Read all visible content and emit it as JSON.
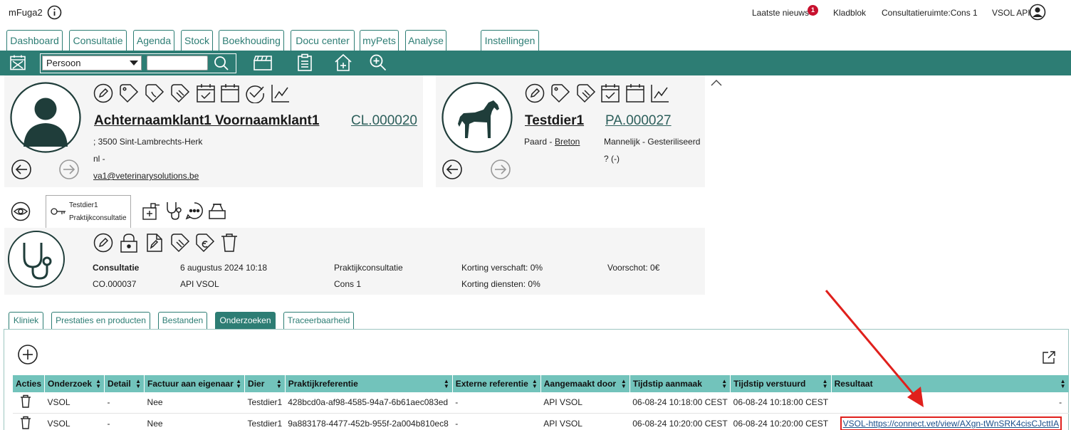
{
  "app": {
    "title": "mFuga2"
  },
  "topnav": {
    "news_label": "Laatste nieuws",
    "news_badge": "1",
    "notepad_label": "Kladblok",
    "room_label": "Consultatieruimte:Cons 1",
    "user_label": "VSOL API"
  },
  "main_tabs": [
    "Dashboard",
    "Consultatie",
    "Agenda",
    "Stock",
    "Boekhouding",
    "Docu center",
    "myPets",
    "Analyse",
    "Instellingen"
  ],
  "toolbar": {
    "search_type": "Persoon",
    "search_value": ""
  },
  "client": {
    "name": "Achternaamklant1 Voornaamklant1",
    "code": "CL.000020",
    "address": "; 3500 Sint-Lambrechts-Herk",
    "language": "nl -",
    "email": "va1@veterinarysolutions.be"
  },
  "animal": {
    "name": "Testdier1",
    "code": "PA.000027",
    "species": "Paard -",
    "breed": "Breton",
    "sex": "Mannelijk - Gesteriliseerd",
    "extra": "? (-)"
  },
  "consult_tab": {
    "line1": "Testdier1",
    "line2": "Praktijkconsultatie"
  },
  "consult": {
    "label": "Consultatie",
    "code": "CO.000037",
    "date": "6 augustus 2024 10:18",
    "by": "API VSOL",
    "type": "Praktijkconsultatie",
    "room": "Cons 1",
    "discount": "Korting verschaft: 0%",
    "discount_services": "Korting diensten: 0%",
    "advance": "Voorschot: 0€"
  },
  "sub_tabs": [
    "Kliniek",
    "Prestaties en producten",
    "Bestanden",
    "Onderzoeken",
    "Traceerbaarheid"
  ],
  "table": {
    "headers": [
      "Acties",
      "Onderzoek",
      "Detail",
      "Factuur aan eigenaar",
      "Dier",
      "Praktijkreferentie",
      "Externe referentie",
      "Aangemaakt door",
      "Tijdstip aanmaak",
      "Tijdstip verstuurd",
      "Resultaat"
    ],
    "rows": [
      {
        "onderzoek": "VSOL",
        "detail": "-",
        "factuur": "Nee",
        "dier": "Testdier1",
        "praktijkref": "428bcd0a-af98-4585-94a7-6b61aec083ed",
        "externeref": "-",
        "door": "API VSOL",
        "aanmaak": "06-08-24 10:18:00 CEST",
        "verstuurd": "06-08-24 10:18:00 CEST",
        "resultaat": "-"
      },
      {
        "onderzoek": "VSOL",
        "detail": "-",
        "factuur": "Nee",
        "dier": "Testdier1",
        "praktijkref": "9a883178-4477-452b-955f-2a004b810ec8",
        "externeref": "-",
        "door": "API VSOL",
        "aanmaak": "06-08-24 10:20:00 CEST",
        "verstuurd": "06-08-24 10:20:00 CEST",
        "resultaat": "VSOL-https://connect.vet/view/AXgn-tWnSRK4cisCJcttIA"
      }
    ]
  },
  "colors": {
    "primary": "#2d7d74",
    "header": "#72c3bb",
    "annotation": "#e0201c"
  }
}
